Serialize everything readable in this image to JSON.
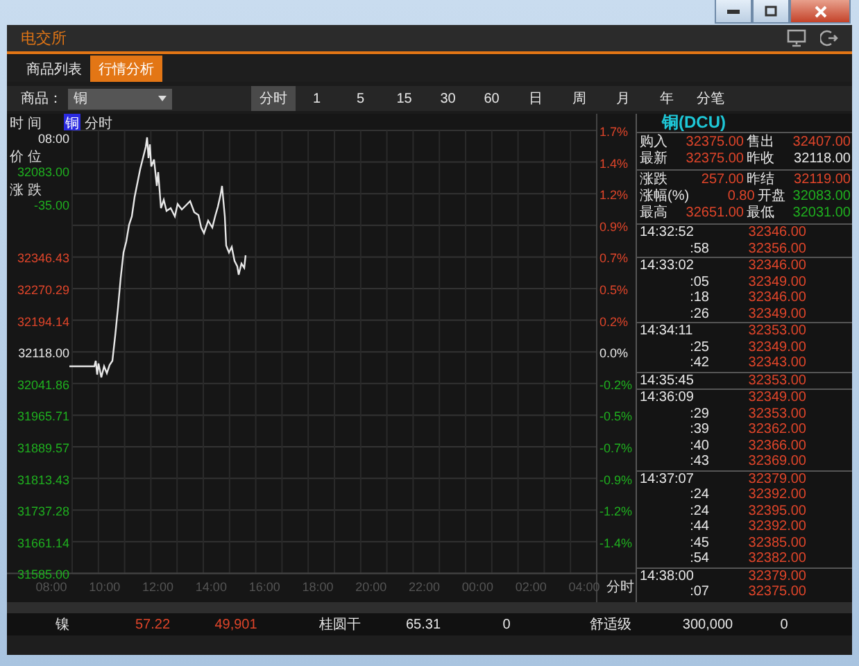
{
  "app_header": {
    "title": "电交所"
  },
  "tabs": [
    {
      "label": "商品列表",
      "selected": false
    },
    {
      "label": "行情分析",
      "selected": true
    }
  ],
  "toolbar": {
    "product_label": "商品：",
    "product_value": "铜",
    "periods": [
      {
        "label": "分时",
        "selected": true
      },
      {
        "label": "1",
        "selected": false
      },
      {
        "label": "5",
        "selected": false
      },
      {
        "label": "15",
        "selected": false
      },
      {
        "label": "30",
        "selected": false
      },
      {
        "label": "60",
        "selected": false
      },
      {
        "label": "日",
        "selected": false
      },
      {
        "label": "周",
        "selected": false
      },
      {
        "label": "月",
        "selected": false
      },
      {
        "label": "年",
        "selected": false
      },
      {
        "label": "分笔",
        "selected": false
      }
    ]
  },
  "chart": {
    "legend_badge": "铜",
    "legend_label": "分时",
    "info": [
      {
        "label": "时 间",
        "value": "08:00",
        "kind": "flat"
      },
      {
        "label": "价 位",
        "value": "32083.00",
        "kind": "down"
      },
      {
        "label": "涨 跌",
        "value": "-35.00",
        "kind": "down"
      }
    ],
    "price_ticks": [
      {
        "label": "32346.43",
        "kind": "up"
      },
      {
        "label": "32270.29",
        "kind": "up"
      },
      {
        "label": "32194.14",
        "kind": "up"
      },
      {
        "label": "32118.00",
        "kind": "flat"
      },
      {
        "label": "32041.86",
        "kind": "down"
      },
      {
        "label": "31965.71",
        "kind": "down"
      },
      {
        "label": "31889.57",
        "kind": "down"
      },
      {
        "label": "31813.43",
        "kind": "down"
      },
      {
        "label": "31737.28",
        "kind": "down"
      },
      {
        "label": "31661.14",
        "kind": "down"
      },
      {
        "label": "31585.00",
        "kind": "down"
      }
    ],
    "percent_ticks": [
      {
        "label": "1.7%",
        "kind": "up"
      },
      {
        "label": "1.4%",
        "kind": "up"
      },
      {
        "label": "1.2%",
        "kind": "up"
      },
      {
        "label": "0.9%",
        "kind": "up"
      },
      {
        "label": "0.7%",
        "kind": "up"
      },
      {
        "label": "0.5%",
        "kind": "up"
      },
      {
        "label": "0.2%",
        "kind": "up"
      },
      {
        "label": "0.0%",
        "kind": "flat"
      },
      {
        "label": "-0.2%",
        "kind": "down"
      },
      {
        "label": "-0.5%",
        "kind": "down"
      },
      {
        "label": "-0.7%",
        "kind": "down"
      },
      {
        "label": "-0.9%",
        "kind": "down"
      },
      {
        "label": "-1.2%",
        "kind": "down"
      },
      {
        "label": "-1.4%",
        "kind": "down"
      }
    ],
    "time_ticks": [
      "08:00",
      "10:00",
      "12:00",
      "14:00",
      "16:00",
      "18:00",
      "20:00",
      "22:00",
      "00:00",
      "02:00",
      "04:00"
    ],
    "axis_mode": "分时"
  },
  "quote": {
    "title": "铜(DCU)",
    "groups": [
      [
        [
          {
            "label": "购入",
            "value": "32375.00",
            "kind": "up"
          },
          {
            "label": "售出",
            "value": "32407.00",
            "kind": "up"
          }
        ],
        [
          {
            "label": "最新",
            "value": "32375.00",
            "kind": "up"
          },
          {
            "label": "昨收",
            "value": "32118.00",
            "kind": "flat"
          }
        ]
      ],
      [
        [
          {
            "label": "涨跌",
            "value": "257.00",
            "kind": "up"
          },
          {
            "label": "昨结",
            "value": "32119.00",
            "kind": "up"
          }
        ],
        [
          {
            "label": "涨幅(%)",
            "value": "0.80",
            "kind": "up"
          },
          {
            "label": "开盘",
            "value": "32083.00",
            "kind": "down"
          }
        ],
        [
          {
            "label": "最高",
            "value": "32651.00",
            "kind": "up"
          },
          {
            "label": "最低",
            "value": "32031.00",
            "kind": "down"
          }
        ]
      ]
    ]
  },
  "ticks": [
    [
      {
        "time": "14:32:52",
        "price": "32346.00"
      },
      {
        "time": ":58",
        "price": "32356.00"
      }
    ],
    [
      {
        "time": "14:33:02",
        "price": "32346.00"
      },
      {
        "time": ":05",
        "price": "32349.00"
      },
      {
        "time": ":18",
        "price": "32346.00"
      },
      {
        "time": ":26",
        "price": "32349.00"
      }
    ],
    [
      {
        "time": "14:34:11",
        "price": "32353.00"
      },
      {
        "time": ":25",
        "price": "32349.00"
      },
      {
        "time": ":42",
        "price": "32343.00"
      }
    ],
    [
      {
        "time": "14:35:45",
        "price": "32353.00"
      }
    ],
    [
      {
        "time": "14:36:09",
        "price": "32349.00"
      },
      {
        "time": ":29",
        "price": "32353.00"
      },
      {
        "time": ":39",
        "price": "32362.00"
      },
      {
        "time": ":40",
        "price": "32366.00"
      },
      {
        "time": ":43",
        "price": "32369.00"
      }
    ],
    [
      {
        "time": "14:37:07",
        "price": "32379.00"
      },
      {
        "time": ":24",
        "price": "32392.00"
      },
      {
        "time": ":24",
        "price": "32395.00"
      },
      {
        "time": ":44",
        "price": "32392.00"
      },
      {
        "time": ":45",
        "price": "32385.00"
      },
      {
        "time": ":54",
        "price": "32382.00"
      }
    ],
    [
      {
        "time": "14:38:00",
        "price": "32379.00"
      },
      {
        "time": ":07",
        "price": "32375.00"
      }
    ]
  ],
  "bottom_row": [
    {
      "text": "镍",
      "kind": "flat"
    },
    {
      "text": "57.22",
      "kind": "up"
    },
    {
      "text": "49,901",
      "kind": "up"
    },
    {
      "text": "桂圆干",
      "kind": "flat"
    },
    {
      "text": "65.31",
      "kind": "flat"
    },
    {
      "text": "0",
      "kind": "flat"
    },
    {
      "text": "舒适级",
      "kind": "flat"
    },
    {
      "text": "300,000",
      "kind": "flat"
    },
    {
      "text": "0",
      "kind": "flat"
    }
  ]
}
